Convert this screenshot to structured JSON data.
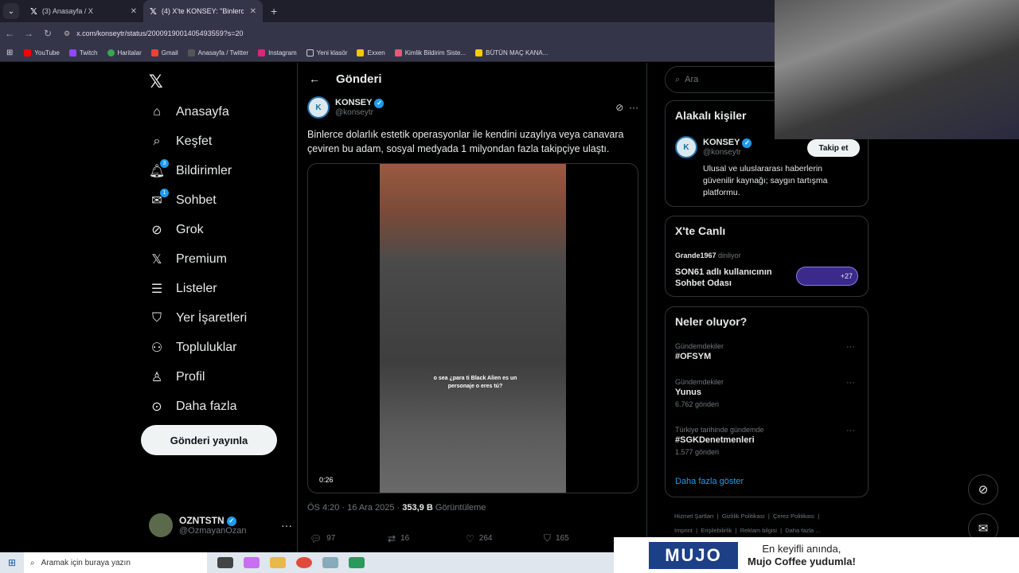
{
  "browser": {
    "tabs": [
      {
        "label": "(3) Anasayfa / X"
      },
      {
        "label": "(4) X'te KONSEY: \"Binlerce dola"
      }
    ],
    "url": "x.com/konseytr/status/2000919001405493559?s=20",
    "bookmarks": [
      "YouTube",
      "Twitch",
      "Haritalar",
      "Gmail",
      "Anasayfa / Twitter",
      "Instagram",
      "Yeni klasör",
      "Exxen",
      "Kimlik Bildirim Siste...",
      "BÜTÜN MAÇ KANA..."
    ]
  },
  "sidebar": {
    "items": [
      {
        "label": "Anasayfa",
        "icon": "home-icon"
      },
      {
        "label": "Keşfet",
        "icon": "search-icon"
      },
      {
        "label": "Bildirimler",
        "icon": "bell-icon",
        "badge": "3"
      },
      {
        "label": "Sohbet",
        "icon": "mail-icon",
        "badge": "1"
      },
      {
        "label": "Grok",
        "icon": "grok-icon"
      },
      {
        "label": "Premium",
        "icon": "x-icon"
      },
      {
        "label": "Listeler",
        "icon": "list-icon"
      },
      {
        "label": "Yer İşaretleri",
        "icon": "bookmark-icon"
      },
      {
        "label": "Topluluklar",
        "icon": "people-icon"
      },
      {
        "label": "Profil",
        "icon": "user-icon"
      },
      {
        "label": "Daha fazla",
        "icon": "more-circle-icon"
      }
    ],
    "post_button": "Gönderi yayınla",
    "profile": {
      "name": "OZNTSTN",
      "handle": "@OzmayanOzan"
    }
  },
  "main": {
    "header_title": "Gönderi",
    "author": {
      "name": "KONSEY",
      "handle": "@konseytr"
    },
    "text": "Binlerce dolarlık estetik operasyonlar ile kendini uzaylıya veya canavara çeviren bu adam, sosyal medyada 1 milyondan fazla takipçiye ulaştı.",
    "video": {
      "caption": "o sea ¿para ti Black Alien es un personaje o eres tú?",
      "duration": "0:26"
    },
    "meta": {
      "time": "ÖS 4:20 · 16 Ara 2025 · ",
      "views": "353,9 B",
      "views_label": " Görüntüleme"
    },
    "actions": {
      "replies": "97",
      "reposts": "16",
      "likes": "264",
      "bookmarks": "165"
    }
  },
  "right": {
    "search_placeholder": "Ara",
    "related": {
      "title": "Alakalı kişiler",
      "name": "KONSEY",
      "handle": "@konseytr",
      "follow": "Takip et",
      "bio": "Ulusal ve uluslararası haberlerin güvenilir kaynağı; saygın tartışma platformu."
    },
    "live": {
      "title": "X'te Canlı",
      "host": "Grande1967",
      "listening": "dinliyor",
      "room": "SON61 adlı kullanıcının Sohbet Odası",
      "count": "+27"
    },
    "trends": {
      "title": "Neler oluyor?",
      "items": [
        {
          "category": "Gündemdekiler",
          "topic": "#OFSYM",
          "count": ""
        },
        {
          "category": "Gündemdekiler",
          "topic": "Yunus",
          "count": "6.762 gönderi"
        },
        {
          "category": "Türkiye tarihinde gündemde",
          "topic": "#SGKDenetmenleri",
          "count": "1.577 gönderi"
        }
      ],
      "show_more": "Daha fazla göster"
    },
    "footer": [
      "Hizmet Şartları",
      "Gizlilik Politikası",
      "Çerez Politikası",
      "Imprint",
      "Erişilebilirlik",
      "Reklam bilgisi",
      "Daha fazla ..."
    ]
  },
  "taskbar": {
    "search_placeholder": "Aramak için buraya yazın"
  },
  "ad": {
    "brand": "MUJO",
    "line1": "En keyifli anında,",
    "line2": "Mujo Coffee yudumla!"
  }
}
